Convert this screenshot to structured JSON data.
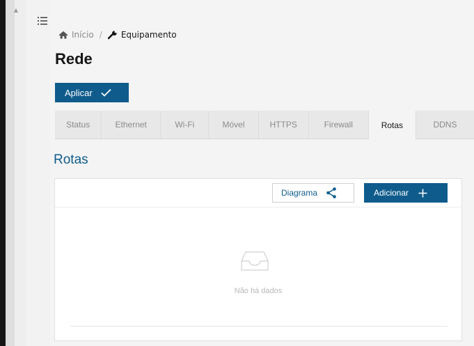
{
  "breadcrumb": {
    "home": "Início",
    "separator": "/",
    "current": "Equipamento"
  },
  "page": {
    "title": "Rede"
  },
  "toolbar": {
    "apply_label": "Aplicar"
  },
  "tabs": [
    {
      "label": "Status"
    },
    {
      "label": "Ethernet"
    },
    {
      "label": "Wi-Fi"
    },
    {
      "label": "Móvel"
    },
    {
      "label": "HTTPS"
    },
    {
      "label": "Firewall"
    },
    {
      "label": "Rotas",
      "active": true
    },
    {
      "label": "DDNS"
    }
  ],
  "section": {
    "title": "Rotas"
  },
  "panel": {
    "diagram_label": "Diagrama",
    "add_label": "Adicionar",
    "empty_text": "Não há dados"
  },
  "icons": {
    "menu": "menu-icon",
    "home": "home-icon",
    "wrench": "wrench-icon",
    "check": "check-icon",
    "share": "share-icon",
    "plus": "plus-icon",
    "empty": "empty-inbox-icon"
  },
  "colors": {
    "accent": "#0f5c8c",
    "background": "#f4f4f4",
    "panel": "#ffffff"
  }
}
